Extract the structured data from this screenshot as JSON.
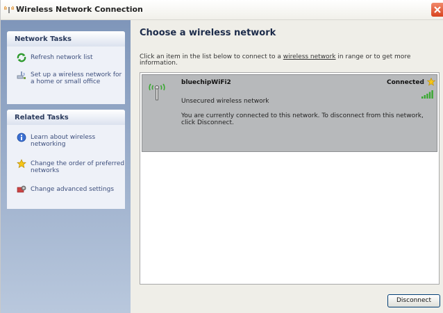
{
  "window": {
    "title": "Wireless Network Connection",
    "close_icon": "close-icon"
  },
  "sidebar": {
    "network_tasks": {
      "heading": "Network Tasks",
      "items": [
        {
          "label": "Refresh network list",
          "icon": "refresh-icon"
        },
        {
          "label": "Set up a wireless network for a home or small office",
          "icon": "setup-network-icon"
        }
      ]
    },
    "related_tasks": {
      "heading": "Related Tasks",
      "items": [
        {
          "label": "Learn about wireless networking",
          "icon": "info-icon"
        },
        {
          "label": "Change the order of preferred networks",
          "icon": "star-icon"
        },
        {
          "label": "Change advanced settings",
          "icon": "settings-icon"
        }
      ]
    }
  },
  "main": {
    "title": "Choose a wireless network",
    "intro_before": "Click an item in the list below to connect to a ",
    "intro_link": "wireless network",
    "intro_after": " in range or to get more information."
  },
  "networks": [
    {
      "name": "bluechipWiFi2",
      "status": "Connected",
      "security": "Unsecured wireless network",
      "message": "You are currently connected to this network. To disconnect from this network, click Disconnect.",
      "signal_bars": 5,
      "selected": true
    }
  ],
  "buttons": {
    "disconnect": "Disconnect"
  },
  "colors": {
    "sidebar_gradient_top": "#7f96ba",
    "sidebar_gradient_bottom": "#b9c8dd",
    "selected_item": "#b7b9bb",
    "signal_green": "#3aa832",
    "close_red": "#d8431f"
  }
}
